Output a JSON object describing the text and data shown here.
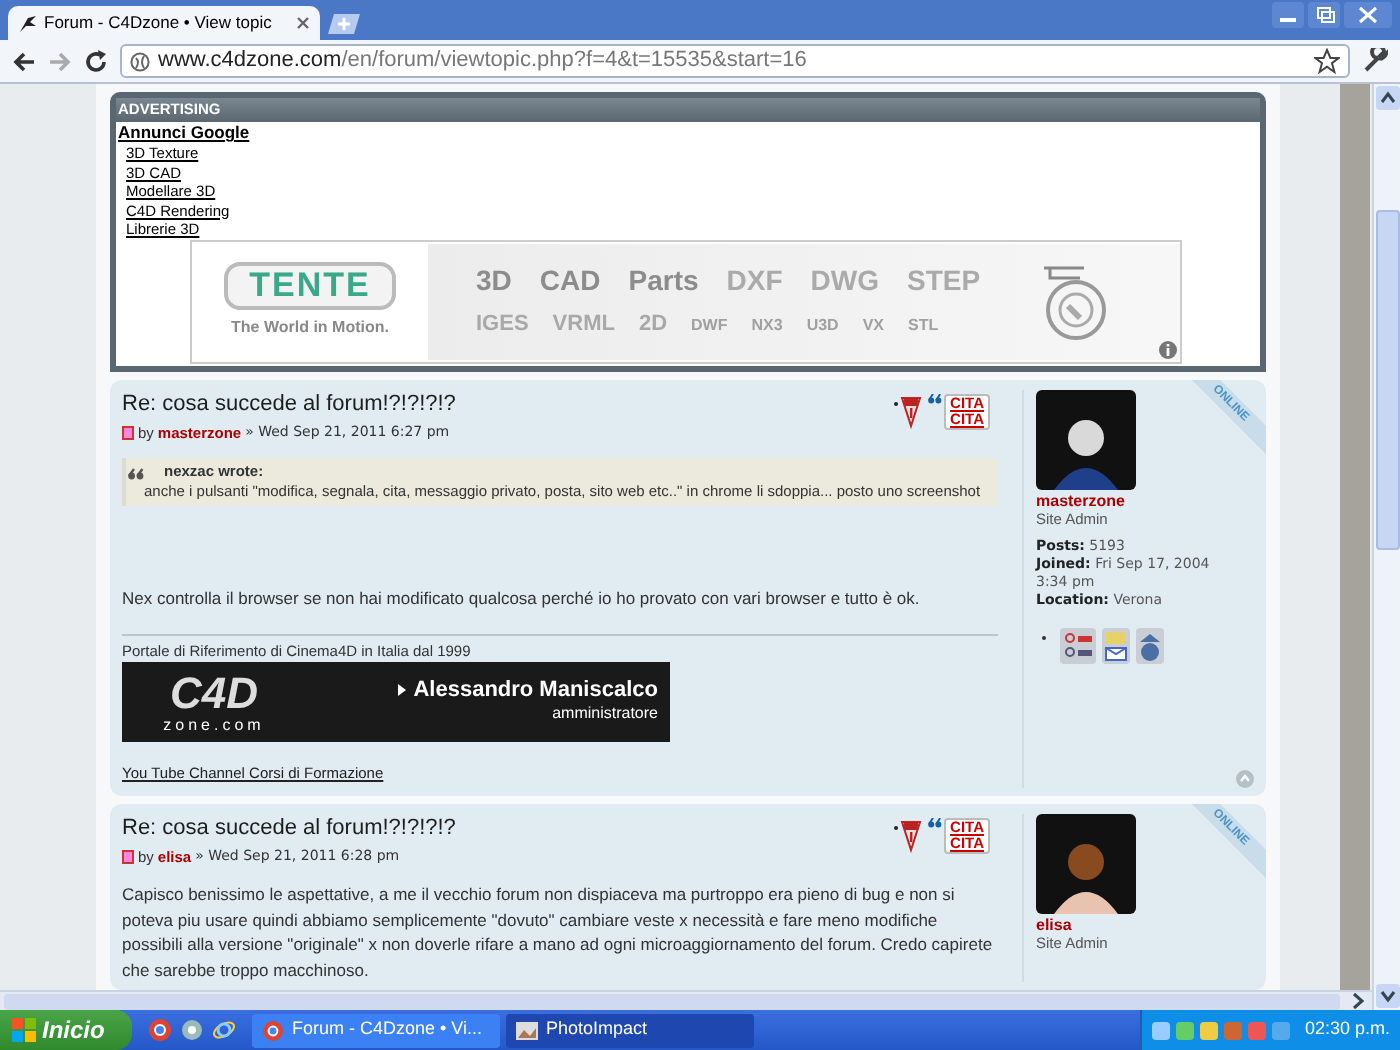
{
  "browser": {
    "tabs": [
      {
        "title": "Forum - C4Dzone • View topic",
        "selected": true
      }
    ],
    "url_host": "www.c4dzone.com",
    "url_path": "/en/forum/viewtopic.php?f=4&t=15535&start=16"
  },
  "advertising": {
    "header": "ADVERTISING",
    "heading": "Annunci Google",
    "links": [
      "3D Texture",
      "3D CAD",
      "Modellare 3D",
      "C4D Rendering",
      "Librerie 3D"
    ],
    "banner": {
      "brand": "TENTE",
      "tagline": "The World in Motion.",
      "formats_1": [
        "3D",
        "CAD",
        "Parts",
        "DXF",
        "DWG",
        "STEP"
      ],
      "formats_2": [
        "IGES",
        "VRML",
        "2D",
        "DWF",
        "NX3",
        "U3D",
        "VX",
        "STL"
      ]
    }
  },
  "posts": [
    {
      "title": "Re: cosa succede al forum!?!?!?!?",
      "by": "by",
      "author": "masterzone",
      "date": "» Wed Sep 21, 2011 6:27 pm",
      "quote_buttons": [
        "CITA",
        "CITA"
      ],
      "quote": {
        "author": "nexzac wrote:",
        "text": "anche i pulsanti \"modifica, segnala, cita, messaggio privato, posta, sito web etc..\" in chrome li sdoppia... posto uno screenshot"
      },
      "body": "Nex controlla il browser se non hai modificato qualcosa perché io ho provato con vari browser e tutto è ok.",
      "signature": {
        "text": "Portale di Riferimento di Cinema4D in Italia dal 1999",
        "logo_top": "C4D",
        "logo_bottom": "zone.com",
        "name": "Alessandro Maniscalco",
        "role": "amministratore",
        "link": "You Tube Channel Corsi di Formazione"
      },
      "profile": {
        "online": "ONLINE",
        "name": "masterzone",
        "rank": "Site Admin",
        "fields": [
          {
            "label": "Posts:",
            "value": "5193"
          },
          {
            "label": "Joined:",
            "value": "Fri Sep 17, 2004 3:34 pm"
          },
          {
            "label": "Location:",
            "value": "Verona"
          }
        ],
        "contacts": true
      }
    },
    {
      "title": "Re: cosa succede al forum!?!?!?!?",
      "by": "by",
      "author": "elisa",
      "date": "» Wed Sep 21, 2011 6:28 pm",
      "quote_buttons": [
        "CITA",
        "CITA"
      ],
      "body": "Capisco benissimo le aspettative, a me il vecchio forum non dispiaceva ma purtroppo era pieno di bug e non si poteva piu usare quindi abbiamo semplicemente \"dovuto\" cambiare veste x necessità e fare meno modifiche possibili alla versione \"originale\" x non doverle rifare a mano ad ogni microaggiornamento del forum. Credo capirete che sarebbe troppo macchinoso.",
      "profile": {
        "online": "ONLINE",
        "name": "elisa",
        "rank": "Site Admin"
      }
    }
  ],
  "taskbar": {
    "start": "Inicio",
    "windows": [
      {
        "label": "Forum - C4Dzone • Vi...",
        "selected": false
      },
      {
        "label": "PhotoImpact",
        "selected": true
      }
    ],
    "clock": "02:30 p.m."
  }
}
